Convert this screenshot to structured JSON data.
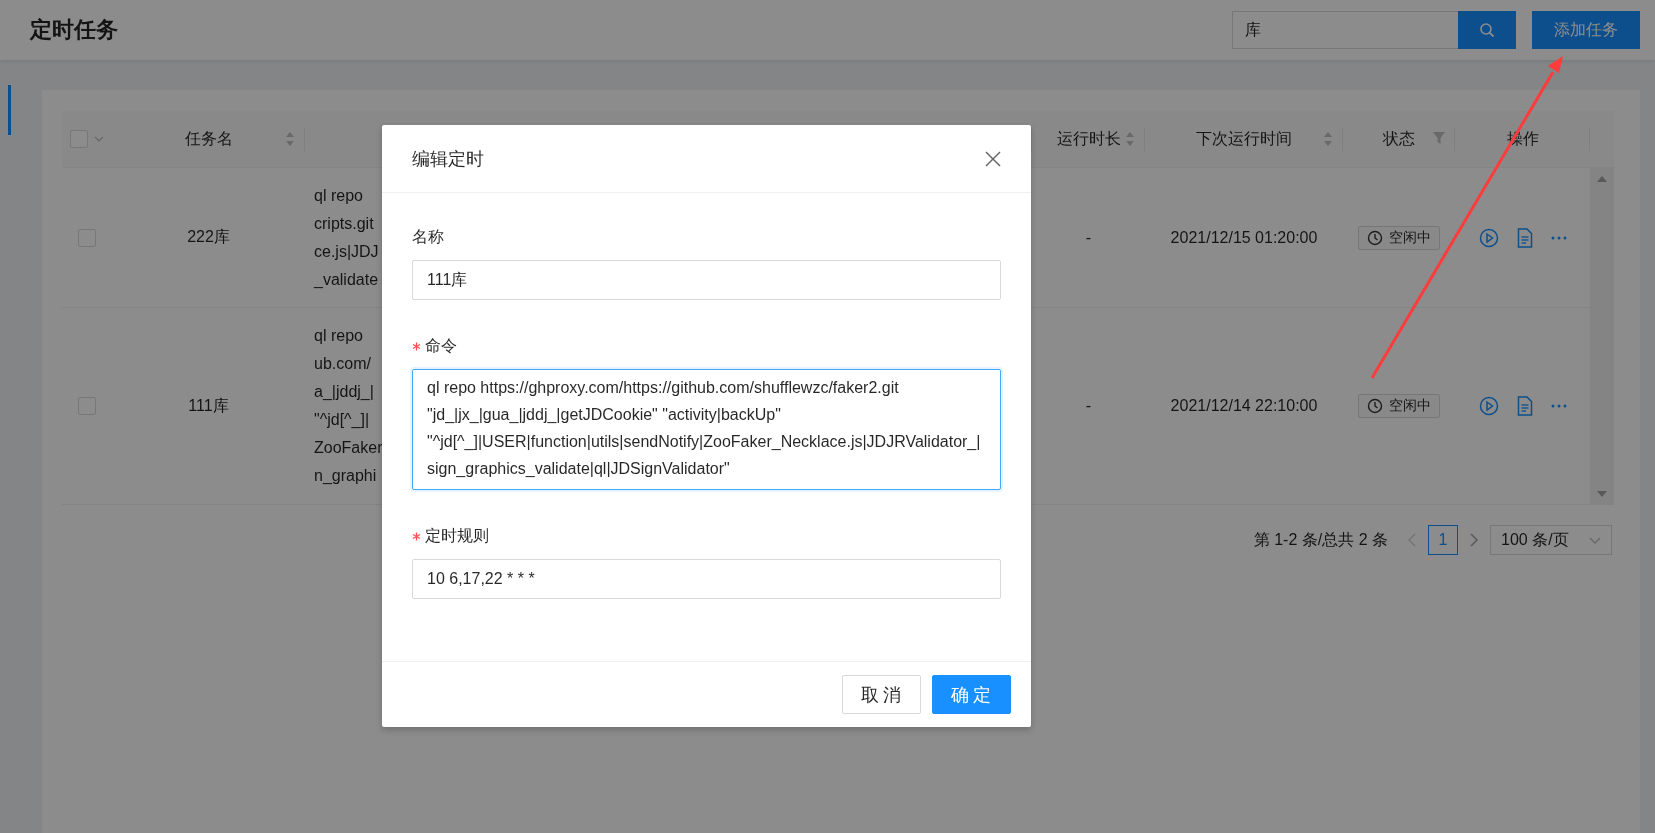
{
  "header": {
    "title": "定时任务",
    "search": {
      "value": "库"
    },
    "add_button": "添加任务"
  },
  "table": {
    "select_all": {
      "checked": false
    },
    "columns": [
      {
        "label": "任务名",
        "kind": "sort"
      },
      {
        "kind": "blank"
      },
      {
        "label": "运行时长",
        "kind": "sort"
      },
      {
        "label": "下次运行时间",
        "kind": "sort"
      },
      {
        "label": "状态",
        "kind": "filter"
      },
      {
        "label": "操作",
        "kind": "plain"
      }
    ],
    "rows": [
      {
        "checked": false,
        "name": "222库",
        "command_lines": [
          "ql repo",
          "cripts.git",
          "ce.js|JDJ",
          "_validate"
        ],
        "runtime": "-",
        "next_run": "2021/12/15 01:20:00",
        "status": "空闲中"
      },
      {
        "checked": false,
        "name": "111库",
        "command_lines": [
          "ql repo",
          "ub.com/",
          "a_|jddj_|",
          "\"^jd[^_]|",
          "ZooFaker",
          "n_graphi"
        ],
        "runtime": "-",
        "next_run": "2021/12/14 22:10:00",
        "status": "空闲中"
      }
    ]
  },
  "pagination": {
    "summary": "第 1-2 条/总共 2 条",
    "prev_disabled": true,
    "pages": [
      {
        "label": "1",
        "selected": true
      }
    ],
    "page_size": "100 条/页"
  },
  "dialog": {
    "title": "编辑定时",
    "fields": [
      {
        "label": "名称",
        "required": false,
        "kind": "input",
        "focused": false,
        "value": "111库"
      },
      {
        "label": "命令",
        "required": true,
        "kind": "textarea",
        "focused": true,
        "value": "ql repo https://ghproxy.com/https://github.com/shufflewzc/faker2.git \"jd_|jx_|gua_|jddj_|getJDCookie\" \"activity|backUp\" \"^jd[^_]|USER|function|utils|sendNotify|ZooFaker_Necklace.js|JDJRValidator_|sign_graphics_validate|ql|JDSignValidator\""
      },
      {
        "label": "定时规则",
        "required": true,
        "kind": "input",
        "focused": false,
        "value": "10 6,17,22 * * *"
      }
    ],
    "buttons": [
      {
        "label": "取消",
        "kind": "default"
      },
      {
        "label": "确定",
        "kind": "primary"
      }
    ]
  }
}
